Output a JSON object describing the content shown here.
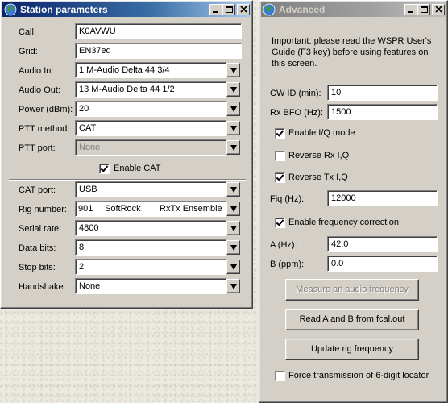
{
  "station": {
    "title": "Station parameters",
    "fields": [
      {
        "label": "Call:",
        "value": "K0AVWU",
        "type": "text"
      },
      {
        "label": "Grid:",
        "value": "EN37ed",
        "type": "text"
      },
      {
        "label": "Audio In:",
        "value": "1 M-Audio Delta 44 3/4",
        "type": "combo"
      },
      {
        "label": "Audio Out:",
        "value": "13 M-Audio Delta 44 1/2",
        "type": "combo"
      },
      {
        "label": "Power (dBm):",
        "value": "20",
        "type": "combo"
      },
      {
        "label": "PTT method:",
        "value": "CAT",
        "type": "combo"
      },
      {
        "label": "PTT port:",
        "value": "None",
        "type": "combo-disabled"
      }
    ],
    "enable_cat_label": "Enable CAT",
    "enable_cat_checked": true,
    "cat_fields": [
      {
        "label": "CAT port:",
        "value": "USB"
      },
      {
        "label": "Rig number:",
        "value_parts": [
          "901",
          "SoftRock",
          "RxTx Ensemble"
        ]
      },
      {
        "label": "Serial rate:",
        "value": "4800"
      },
      {
        "label": "Data bits:",
        "value": "8"
      },
      {
        "label": "Stop bits:",
        "value": "2"
      },
      {
        "label": "Handshake:",
        "value": "None"
      }
    ]
  },
  "advanced": {
    "title": "Advanced",
    "note": "Important:   please read the WSPR User's Guide (F3 key) before using features on this screen.",
    "cw_id_label": "CW ID (min):",
    "cw_id_value": "10",
    "rx_bfo_label": "Rx BFO (Hz):",
    "rx_bfo_value": "1500",
    "enable_iq_label": "Enable I/Q mode",
    "enable_iq_checked": true,
    "reverse_rx_label": "Reverse Rx I,Q",
    "reverse_rx_checked": false,
    "reverse_tx_label": "Reverse Tx I,Q",
    "reverse_tx_checked": true,
    "fiq_label": "Fiq (Hz):",
    "fiq_value": "12000",
    "enable_freq_corr_label": "Enable frequency correction",
    "enable_freq_corr_checked": true,
    "a_label": "A (Hz):",
    "a_value": "42.0",
    "b_label": "B (ppm):",
    "b_value": "0.0",
    "measure_button": "Measure an audio frequency",
    "read_ab_button": "Read A and B from fcal.out",
    "update_rig_button": "Update rig frequency",
    "force_6digit_label": "Force transmission of 6-digit locator",
    "force_6digit_checked": false
  },
  "colors": {
    "active_title": "#0a246a",
    "inactive_title": "#808080",
    "face": "#d4d0c8"
  },
  "icons": [
    "globe-app-icon",
    "minimize-icon",
    "maximize-icon",
    "close-icon",
    "chevron-down-icon"
  ]
}
